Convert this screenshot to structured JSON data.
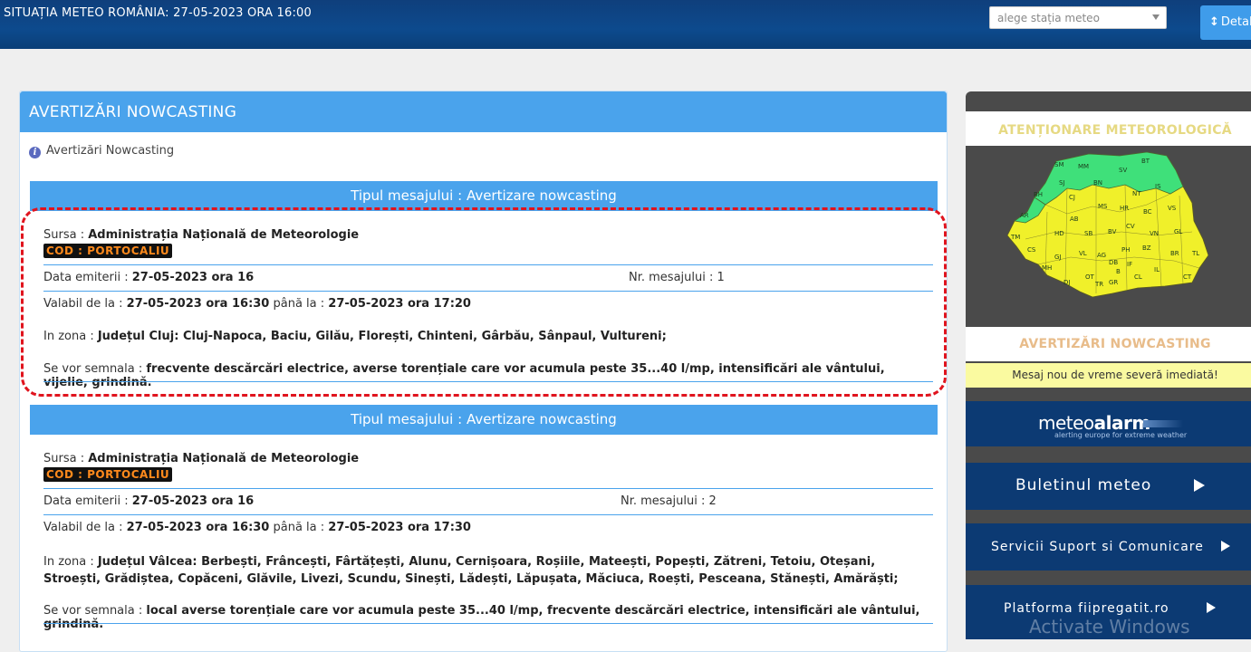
{
  "topbar": {
    "title": "SITUAȚIA METEO ROMÂNIA: 27-05-2023 ORA 16:00",
    "station_placeholder": "alege stația meteo",
    "detail_label": "Detalii"
  },
  "panel": {
    "title": "AVERTIZĂRI NOWCASTING",
    "subtitle": "Avertizări Nowcasting"
  },
  "messages": [
    {
      "header": "Tipul mesajului : Avertizare nowcasting",
      "source_label": "Sursa : ",
      "source": "Administrația Națională de Meteorologie",
      "code": "COD : PORTOCALIU",
      "issued_label": "Data emiterii : ",
      "issued": "27-05-2023 ora 16",
      "nr_label": "Nr. mesajului : ",
      "nr": "1",
      "valid_from_label": "Valabil de la : ",
      "valid_from": "27-05-2023 ora 16:30",
      "valid_to_label": " până la : ",
      "valid_to": "27-05-2023 ora 17:20",
      "zone_label": "In zona : ",
      "zone": "Județul Cluj: Cluj-Napoca, Baciu, Gilău, Florești, Chinteni, Gârbău, Sânpaul, Vultureni;",
      "signal_label": "Se vor semnala : ",
      "signal": "frecvente descărcări electrice, averse torențiale care vor acumula peste 35...40 l/mp, intensificări ale vântului, vijelie, grindină."
    },
    {
      "header": "Tipul mesajului : Avertizare nowcasting",
      "source_label": "Sursa : ",
      "source": "Administrația Națională de Meteorologie",
      "code": "COD : PORTOCALIU",
      "issued_label": "Data emiterii : ",
      "issued": "27-05-2023 ora 16",
      "nr_label": "Nr. mesajului : ",
      "nr": "2",
      "valid_from_label": "Valabil de la : ",
      "valid_from": "27-05-2023 ora 16:30",
      "valid_to_label": " până la : ",
      "valid_to": "27-05-2023 ora 17:30",
      "zone_label": "In zona : ",
      "zone": "Județul Vâlcea: Berbești, Frâncești, Fârtățești, Alunu, Cernișoara, Roșiile, Mateești, Popești, Zătreni, Tetoiu, Oteșani, Stroești, Grădiștea, Copăceni, Glăvile, Livezi, Scundu, Sinești, Lădești, Lăpușata, Măciuca, Roești, Pesceana, Stănești, Amărăști;",
      "signal_label": "Se vor semnala : ",
      "signal": "local averse torențiale care vor acumula peste 35...40 l/mp, frecvente descărcări electrice, intensificări ale vântului, grindină."
    }
  ],
  "sidebar": {
    "warning_title": "ATENȚIONARE METEOROLOGICĂ",
    "nowcasting_title": "AVERTIZĂRI NOWCASTING",
    "new_message": "Mesaj nou de vreme severă imediată!",
    "meteoalarm_light": "meteo",
    "meteoalarm_bold": "alarm",
    "meteoalarm_tagline": "alerting europe for extreme weather",
    "buletin_label": "Buletinul meteo",
    "servicii_label": "Servicii Suport si Comunicare",
    "platforma_label": "Platforma fiipregatit.ro",
    "map_counties": [
      "SM",
      "MM",
      "SV",
      "BT",
      "SJ",
      "BN",
      "BH",
      "CJ",
      "NT",
      "IS",
      "MS",
      "HR",
      "AR",
      "AB",
      "BC",
      "VS",
      "CV",
      "HD",
      "SB",
      "BV",
      "VN",
      "GL",
      "TM",
      "VL",
      "AG",
      "PH",
      "BZ",
      "CS",
      "GJ",
      "DB",
      "BR",
      "TL",
      "IF",
      "MH",
      "OT",
      "TR",
      "GR",
      "CL",
      "IL",
      "CT",
      "DJ",
      "B"
    ],
    "colors": {
      "yellow": "#f0f02a",
      "green": "#3fe07a",
      "text_yellow": "#e3d77a"
    }
  },
  "watermark": "Activate Windows"
}
